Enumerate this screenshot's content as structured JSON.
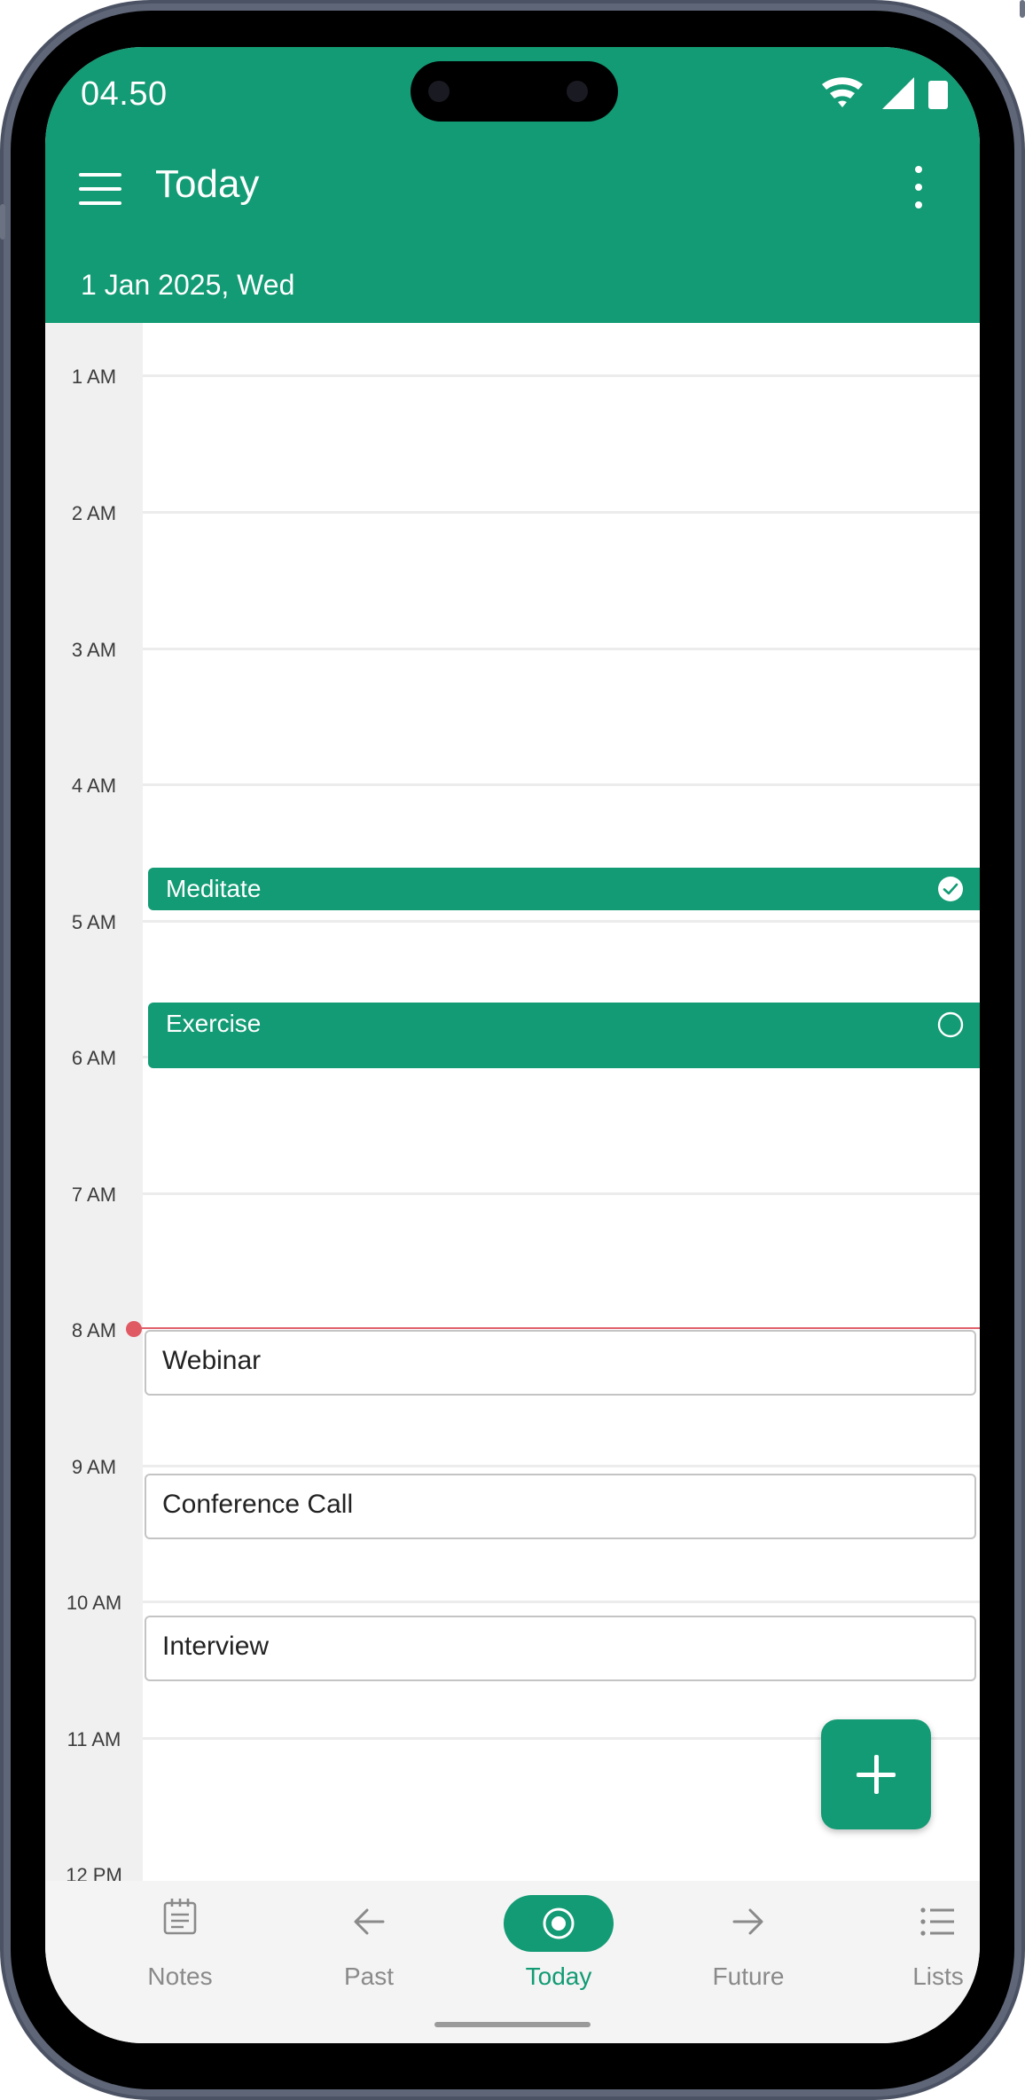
{
  "status": {
    "time": "04.50"
  },
  "appbar": {
    "title": "Today",
    "date": "1 Jan 2025, Wed"
  },
  "hours": [
    "1 AM",
    "2 AM",
    "3 AM",
    "4 AM",
    "5 AM",
    "6 AM",
    "7 AM",
    "8 AM",
    "9 AM",
    "10 AM",
    "11 AM",
    "12 PM"
  ],
  "events": {
    "meditate": {
      "title": "Meditate",
      "done": true
    },
    "exercise": {
      "title": "Exercise",
      "done": false
    },
    "webinar": {
      "title": "Webinar"
    },
    "conference_call": {
      "title": "Conference Call"
    },
    "interview": {
      "title": "Interview"
    }
  },
  "nav": [
    {
      "label": "Notes",
      "icon": "notes-icon",
      "active": false
    },
    {
      "label": "Past",
      "icon": "arrow-left-icon",
      "active": false
    },
    {
      "label": "Today",
      "icon": "target-icon",
      "active": true
    },
    {
      "label": "Future",
      "icon": "arrow-right-icon",
      "active": false
    },
    {
      "label": "Lists",
      "icon": "list-icon",
      "active": false
    }
  ],
  "colors": {
    "primary": "#129b74",
    "now_indicator": "#e05a64"
  }
}
